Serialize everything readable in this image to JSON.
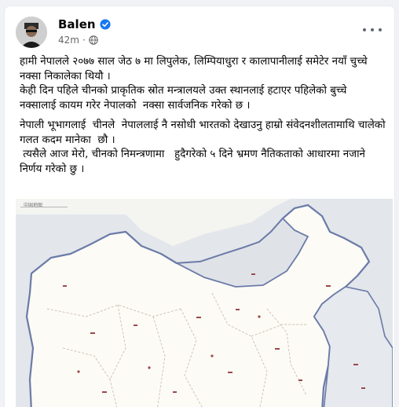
{
  "post": {
    "author": "Balen",
    "time": "42m",
    "icons": {
      "verified": "verified-badge-icon",
      "audience": "globe-icon",
      "more": "more-options-icon"
    },
    "paragraphs": [
      "हामी नेपालले २०७७ साल जेठ ७ मा लिपुलेक, लिम्पियाधुरा र कालापानीलाई समेटेर नयाँ चुच्चे नक्सा निकालेका थियौ ।",
      "केही दिन पहिले चीनको प्राकृतिक स्रोत मन्त्रालयले उक्त स्थानलाई हटाएर पहिलेको बुच्चे नक्सालाई कायम गरेर नेपालको  नक्सा सार्वजनिक गरेको छ ।",
      "नेपाली भूभागलाई  चीनले  नेपाललाई नै नसोधी भारतको देखाउनु हाम्रो संवेदनशीलतामाथि चालेको गलत कदम मानेका  छौ ।",
      " त्यसैले आज मेरो, चीनको निमन्त्रणामा   हुदैगरेको ५ दिने भ्रमण नैतिकताको आधारमा नजाने निर्णय गरेको छु ।"
    ]
  },
  "map": {
    "label": "中国地图",
    "colors": {
      "china_fill": "#fdfbf6",
      "outside_fill": "#dfe3e8",
      "border": "#6b7ba8",
      "province_lines": "#c9bfae",
      "marks": "#9a4a4a"
    }
  },
  "colors": {
    "verified_blue": "#1877f2",
    "secondary_text": "#65676b",
    "primary_text": "#050505"
  }
}
